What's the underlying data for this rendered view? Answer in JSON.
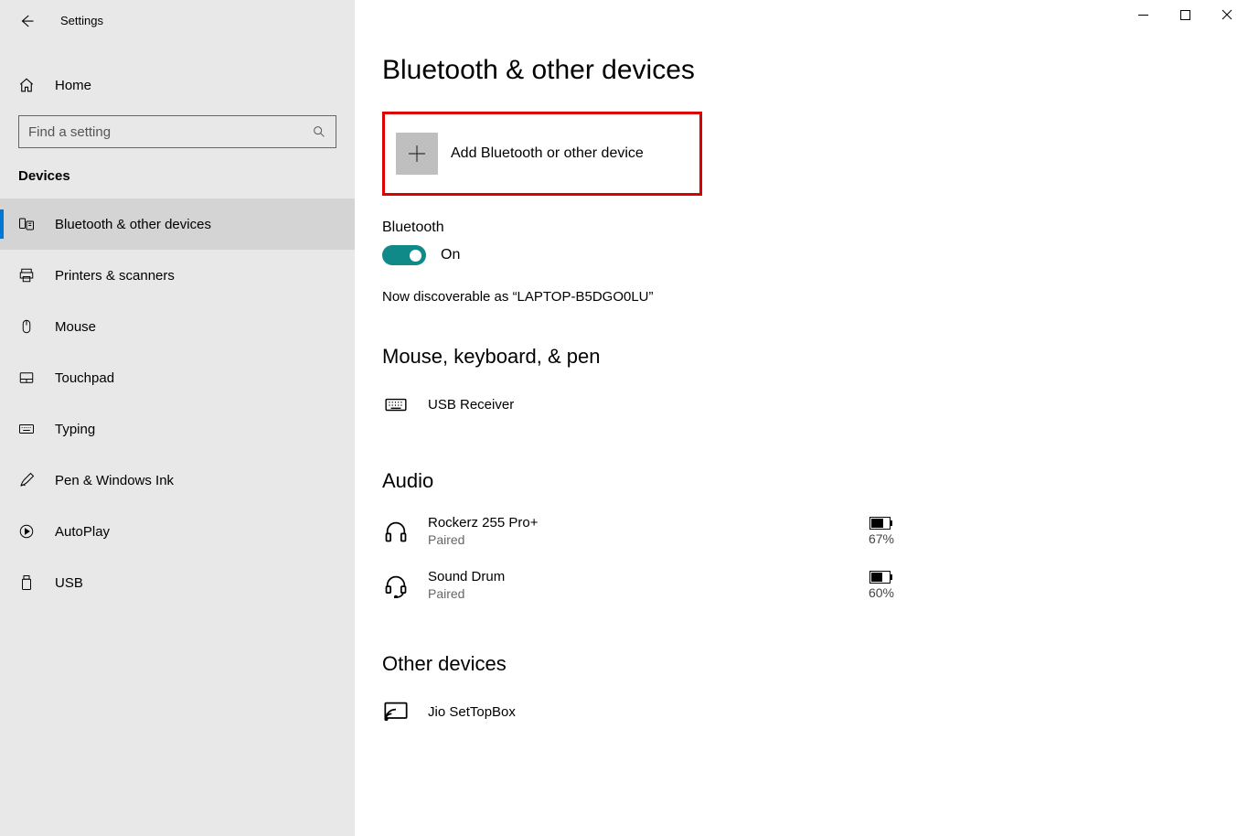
{
  "header": {
    "app_title": "Settings",
    "home_label": "Home"
  },
  "search": {
    "placeholder": "Find a setting"
  },
  "sidebar": {
    "section": "Devices",
    "items": [
      {
        "label": "Bluetooth & other devices",
        "icon": "bluetooth-devices-icon",
        "selected": true
      },
      {
        "label": "Printers & scanners",
        "icon": "printer-icon",
        "selected": false
      },
      {
        "label": "Mouse",
        "icon": "mouse-icon",
        "selected": false
      },
      {
        "label": "Touchpad",
        "icon": "touchpad-icon",
        "selected": false
      },
      {
        "label": "Typing",
        "icon": "keyboard-icon",
        "selected": false
      },
      {
        "label": "Pen & Windows Ink",
        "icon": "pen-icon",
        "selected": false
      },
      {
        "label": "AutoPlay",
        "icon": "autoplay-icon",
        "selected": false
      },
      {
        "label": "USB",
        "icon": "usb-icon",
        "selected": false
      }
    ]
  },
  "main": {
    "title": "Bluetooth & other devices",
    "add_button": "Add Bluetooth or other device",
    "bluetooth_label": "Bluetooth",
    "toggle_state": "On",
    "discoverable": "Now discoverable as “LAPTOP-B5DGO0LU”",
    "sections": {
      "mouse_keyboard_pen": {
        "title": "Mouse, keyboard, & pen",
        "devices": [
          {
            "name": "USB Receiver",
            "status": "",
            "icon": "keyboard-icon",
            "battery": ""
          }
        ]
      },
      "audio": {
        "title": "Audio",
        "devices": [
          {
            "name": "Rockerz 255 Pro+",
            "status": "Paired",
            "icon": "headphones-icon",
            "battery": "67%"
          },
          {
            "name": "Sound Drum",
            "status": "Paired",
            "icon": "headset-icon",
            "battery": "60%"
          }
        ]
      },
      "other": {
        "title": "Other devices",
        "devices": [
          {
            "name": "Jio SetTopBox",
            "status": "",
            "icon": "cast-icon",
            "battery": ""
          }
        ]
      }
    }
  }
}
